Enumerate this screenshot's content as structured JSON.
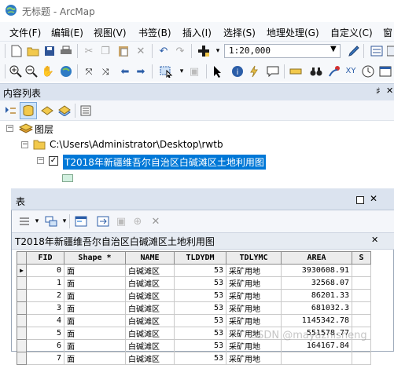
{
  "window": {
    "title": "无标题 - ArcMap"
  },
  "menu": [
    "文件(F)",
    "编辑(E)",
    "视图(V)",
    "书签(B)",
    "插入(I)",
    "选择(S)",
    "地理处理(G)",
    "自定义(C)",
    "窗"
  ],
  "toolbar": {
    "scale": "1:20,000"
  },
  "toc": {
    "title": "内容列表",
    "pin": "♯",
    "close": "✕",
    "root_label": "图层",
    "folder_label": "C:\\Users\\Administrator\\Desktop\\rwtb",
    "layer_label": "T2018年新疆维吾尔自治区白碱滩区土地利用图"
  },
  "table_window": {
    "title": "表",
    "tab_label": "T2018年新疆维吾尔自治区白碱滩区土地利用图",
    "tab_close": "✕",
    "columns": [
      "FID",
      "Shape *",
      "NAME",
      "TLDYDM",
      "TDLYMC",
      "AREA",
      "S"
    ],
    "rows": [
      {
        "fid": "0",
        "shape": "面",
        "name": "白碱滩区",
        "tldydm": "53",
        "tdlymc": "采矿用地",
        "area": "3930608.91",
        "current": true
      },
      {
        "fid": "1",
        "shape": "面",
        "name": "白碱滩区",
        "tldydm": "53",
        "tdlymc": "采矿用地",
        "area": "32568.07",
        "current": false
      },
      {
        "fid": "2",
        "shape": "面",
        "name": "白碱滩区",
        "tldydm": "53",
        "tdlymc": "采矿用地",
        "area": "86201.33",
        "current": false
      },
      {
        "fid": "3",
        "shape": "面",
        "name": "白碱滩区",
        "tldydm": "53",
        "tdlymc": "采矿用地",
        "area": "681032.3",
        "current": false
      },
      {
        "fid": "4",
        "shape": "面",
        "name": "白碱滩区",
        "tldydm": "53",
        "tdlymc": "采矿用地",
        "area": "1145342.78",
        "current": false
      },
      {
        "fid": "5",
        "shape": "面",
        "name": "白碱滩区",
        "tldydm": "53",
        "tdlymc": "采矿用地",
        "area": "551578.77",
        "current": false
      },
      {
        "fid": "6",
        "shape": "面",
        "name": "白碱滩区",
        "tldydm": "53",
        "tdlymc": "采矿用地",
        "area": "164167.84",
        "current": false
      },
      {
        "fid": "7",
        "shape": "面",
        "name": "白碱滩区",
        "tldydm": "53",
        "tdlymc": "采矿用地",
        "area": "",
        "current": false
      }
    ]
  },
  "watermark": "CSDN @mayazhisheng",
  "colors": {
    "accent": "#0078d7",
    "panel_header": "#dbe3ef",
    "toolbar_bg": "#f6f8fb"
  }
}
